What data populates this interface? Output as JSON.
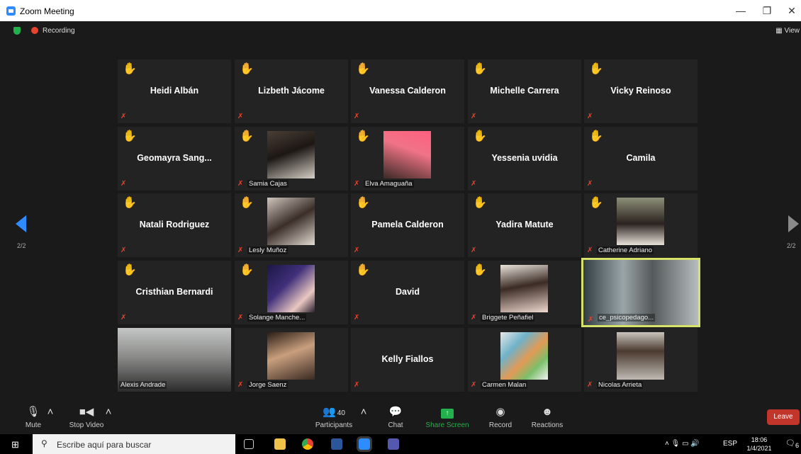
{
  "window": {
    "title": "Zoom Meeting",
    "minimize": "—",
    "restore": "❐",
    "close": "✕"
  },
  "meeting": {
    "recording_label": "Recording",
    "view_label": "View"
  },
  "pager": {
    "left": "2/2",
    "right": "2/2"
  },
  "participants": [
    {
      "name": "Heidi Albán",
      "hand": true,
      "video": false
    },
    {
      "name": "Lizbeth Jácome",
      "hand": true,
      "video": false
    },
    {
      "name": "Vanessa Calderon",
      "hand": true,
      "video": false
    },
    {
      "name": "Michelle Carrera",
      "hand": true,
      "video": false
    },
    {
      "name": "Vicky Reinoso",
      "hand": true,
      "video": false
    },
    {
      "name": "Geomayra  Sang...",
      "hand": true,
      "video": false
    },
    {
      "name": "Samia Cajas",
      "hand": true,
      "video": true
    },
    {
      "name": "Elva Amaguaña",
      "hand": true,
      "video": true
    },
    {
      "name": "Yessenia uvidia",
      "hand": true,
      "video": false
    },
    {
      "name": "Camila",
      "hand": true,
      "video": false
    },
    {
      "name": "Natali Rodriguez",
      "hand": true,
      "video": false
    },
    {
      "name": "Lesly Muñoz",
      "hand": true,
      "video": true
    },
    {
      "name": "Pamela Calderon",
      "hand": true,
      "video": false
    },
    {
      "name": "Yadira Matute",
      "hand": true,
      "video": false
    },
    {
      "name": "Catherine Adriano",
      "hand": true,
      "video": true
    },
    {
      "name": "Cristhian Bernardi",
      "hand": true,
      "video": false
    },
    {
      "name": "Solange Manche...",
      "hand": true,
      "video": true
    },
    {
      "name": "David",
      "hand": true,
      "video": false
    },
    {
      "name": "Briggete Peñafiel",
      "hand": true,
      "video": true
    },
    {
      "name": "ce_psicopedago...",
      "hand": false,
      "video": true,
      "active": true
    },
    {
      "name": "Alexis Andrade",
      "hand": false,
      "video": true,
      "muted": false
    },
    {
      "name": "Jorge Saenz",
      "hand": false,
      "video": true
    },
    {
      "name": "Kelly Fiallos",
      "hand": false,
      "video": false
    },
    {
      "name": "Carmen Malan",
      "hand": false,
      "video": true
    },
    {
      "name": "Nicolas Arrieta",
      "hand": false,
      "video": true
    }
  ],
  "toolbar": {
    "mute": "Mute",
    "stop_video": "Stop Video",
    "participants": "Participants",
    "participants_count": "40",
    "chat": "Chat",
    "share_screen": "Share Screen",
    "record": "Record",
    "reactions": "Reactions",
    "leave": "Leave"
  },
  "taskbar": {
    "search_placeholder": "Escribe aquí para buscar",
    "lang": "ESP",
    "time": "18:06",
    "date": "1/4/2021",
    "notifications": "6"
  },
  "colors": {
    "accent": "#2d8cff",
    "share": "#22b14c",
    "leave": "#c2352b",
    "active_border": "#d6e26a"
  }
}
